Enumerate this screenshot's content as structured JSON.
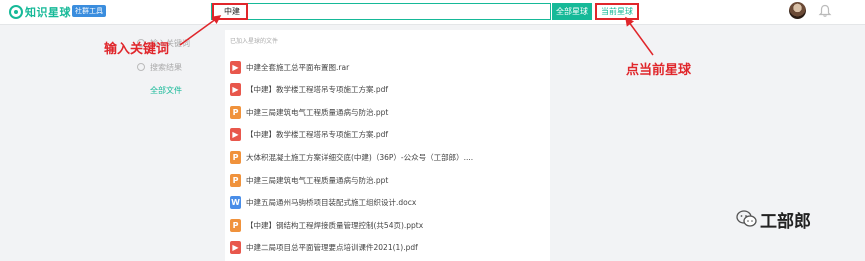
{
  "app": {
    "logo_text": "知识星球",
    "logo_badge": "社群工具"
  },
  "search": {
    "value": "中建",
    "all_planets_label": "全部星球",
    "current_planet_label": "当前星球"
  },
  "sidebar": {
    "items": [
      {
        "label": "输入关键词",
        "icon": "search-icon"
      },
      {
        "label": "搜索结果",
        "icon": "search-icon"
      },
      {
        "label": "全部文件"
      }
    ]
  },
  "annotations": {
    "left": "输入关键词",
    "right": "点当前星球"
  },
  "file_panel": {
    "header": "已加入星球的文件",
    "files": [
      {
        "type": "rar",
        "icon_letter": "▶",
        "color": "#e8574c",
        "name": "中建全套施工总平面布置图.rar"
      },
      {
        "type": "pdf",
        "icon_letter": "▶",
        "color": "#e8574c",
        "name": "【中建】教学楼工程塔吊专项施工方案.pdf"
      },
      {
        "type": "ppt",
        "icon_letter": "P",
        "color": "#f0923c",
        "name": "中建三局建筑电气工程质量通病与防治.ppt"
      },
      {
        "type": "pdf",
        "icon_letter": "▶",
        "color": "#e8574c",
        "name": "【中建】教学楼工程塔吊专项施工方案.pdf"
      },
      {
        "type": "ppt",
        "icon_letter": "P",
        "color": "#f0923c",
        "name": "大体积混凝土施工方案详细交底(中建)（36P）-公众号（工部郎）...."
      },
      {
        "type": "ppt",
        "icon_letter": "P",
        "color": "#f0923c",
        "name": "中建三局建筑电气工程质量通病与防治.ppt"
      },
      {
        "type": "docx",
        "icon_letter": "W",
        "color": "#4a8ee8",
        "name": "中建五局通州马驹桥项目装配式施工组织设计.docx"
      },
      {
        "type": "pptx",
        "icon_letter": "P",
        "color": "#f0923c",
        "name": "【中建】钢结构工程焊接质量管理控制(共54页).pptx"
      },
      {
        "type": "pdf",
        "icon_letter": "▶",
        "color": "#e8574c",
        "name": "中建二局项目总平面管理要点培训课件2021(1).pdf"
      }
    ]
  },
  "watermark": {
    "text": "工部郎"
  },
  "colors": {
    "brand": "#16b998",
    "annotation_red": "#e0262b"
  }
}
